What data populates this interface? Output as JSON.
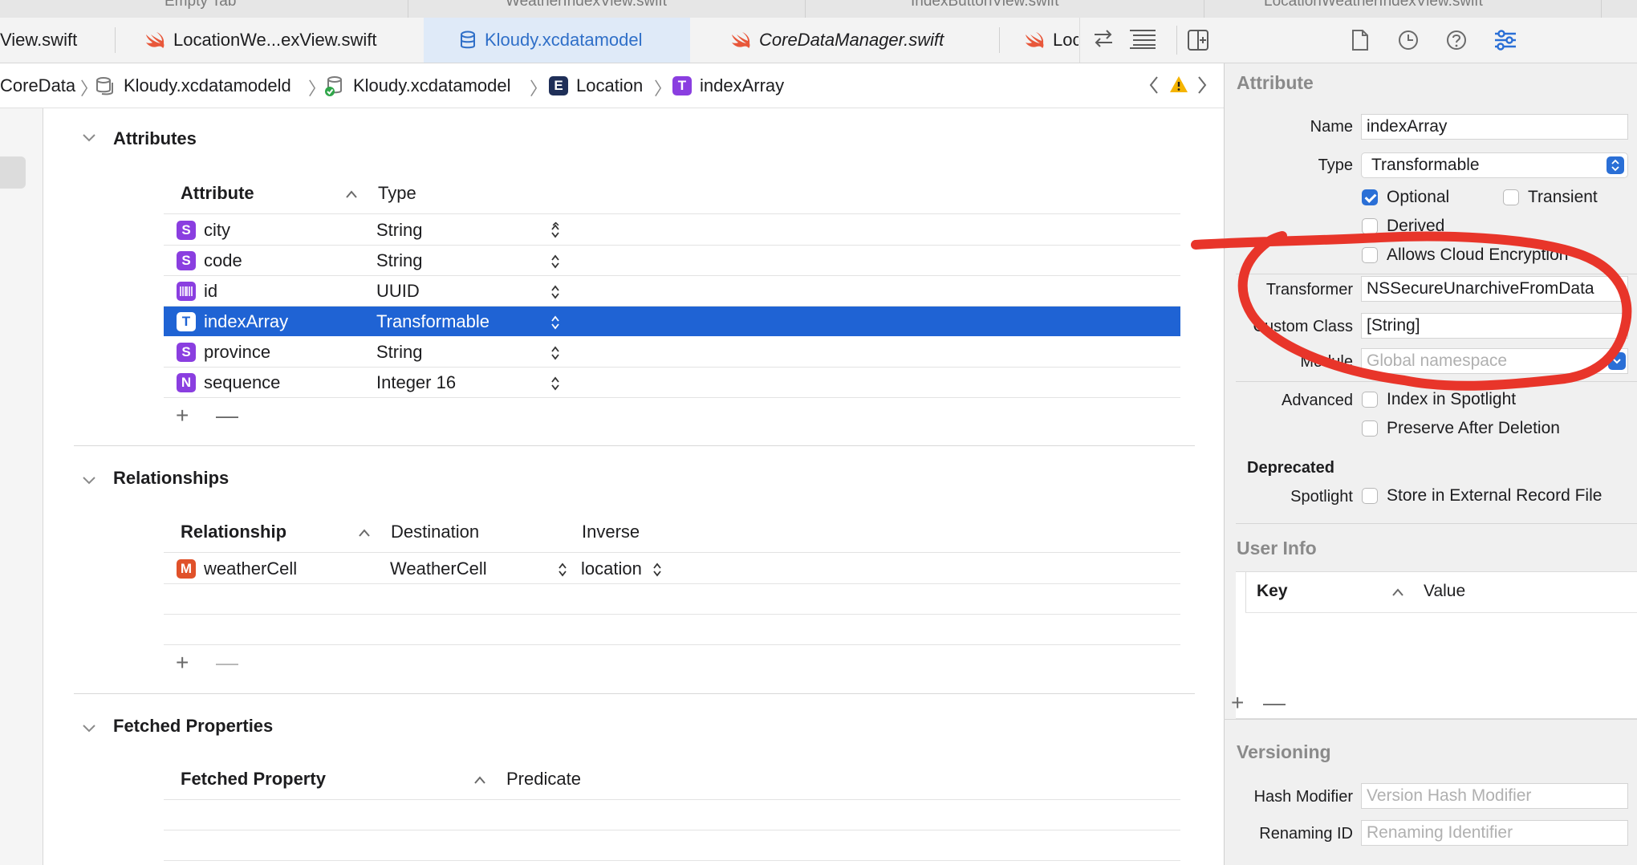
{
  "top_files": [
    "Empty Tab",
    "WeatherIndexView.swift",
    "IndexButtonView.swift",
    "LocationWeatherIndexView.swift"
  ],
  "tabs": [
    {
      "label": "View.swift",
      "icon": "none",
      "active": false
    },
    {
      "label": "LocationWe...exView.swift",
      "icon": "swift-icon",
      "active": false
    },
    {
      "label": "Kloudy.xcdatamodel",
      "icon": "datamodel-icon",
      "active": true
    },
    {
      "label": "CoreDataManager.swift",
      "icon": "swift-icon",
      "active": false
    },
    {
      "label": "Loc",
      "icon": "swift-icon",
      "active": false
    }
  ],
  "breadcrumb": [
    {
      "label": "CoreData"
    },
    {
      "label": "Kloudy.xcdatamodeld"
    },
    {
      "label": "Kloudy.xcdatamodel"
    },
    {
      "label": "Location",
      "badge": "E"
    },
    {
      "label": "indexArray",
      "badge": "T"
    }
  ],
  "attributes_section": {
    "title": "Attributes",
    "col_attribute": "Attribute",
    "col_type": "Type",
    "rows": [
      {
        "badge": "S",
        "name": "city",
        "type": "String",
        "selected": false
      },
      {
        "badge": "S",
        "name": "code",
        "type": "String",
        "selected": false
      },
      {
        "badge": "id-icon",
        "name": "id",
        "type": "UUID",
        "selected": false
      },
      {
        "badge": "T",
        "name": "indexArray",
        "type": "Transformable",
        "selected": true
      },
      {
        "badge": "S",
        "name": "province",
        "type": "String",
        "selected": false
      },
      {
        "badge": "N",
        "name": "sequence",
        "type": "Integer 16",
        "selected": false
      }
    ]
  },
  "relationships_section": {
    "title": "Relationships",
    "col_relationship": "Relationship",
    "col_destination": "Destination",
    "col_inverse": "Inverse",
    "rows": [
      {
        "badge": "M",
        "name": "weatherCell",
        "destination": "WeatherCell",
        "inverse": "location"
      }
    ]
  },
  "fetched_section": {
    "title": "Fetched Properties",
    "col_fetched": "Fetched Property",
    "col_predicate": "Predicate"
  },
  "controls": {
    "add": "+",
    "remove": "—"
  },
  "inspector": {
    "attribute_title": "Attribute",
    "name_label": "Name",
    "name_value": "indexArray",
    "type_label": "Type",
    "type_value": "Transformable",
    "optional_label": "Optional",
    "optional_checked": true,
    "transient_label": "Transient",
    "transient_checked": false,
    "derived_label": "Derived",
    "cloud_label": "Allows Cloud Encryption",
    "transformer_label": "Transformer",
    "transformer_value": "NSSecureUnarchiveFromData",
    "custom_class_label": "Custom Class",
    "custom_class_value": "[String]",
    "module_label": "Module",
    "module_placeholder": "Global namespace",
    "advanced_label": "Advanced",
    "spotlight_index_label": "Index in Spotlight",
    "preserve_label": "Preserve After Deletion",
    "deprecated_label": "Deprecated",
    "spotlight_label": "Spotlight",
    "external_label": "Store in External Record File",
    "user_info_title": "User Info",
    "key_col": "Key",
    "value_col": "Value",
    "versioning_title": "Versioning",
    "hash_label": "Hash Modifier",
    "hash_placeholder": "Version Hash Modifier",
    "renaming_label": "Renaming ID",
    "renaming_placeholder": "Renaming Identifier"
  },
  "colors": {
    "accent": "#1f63d4",
    "annotation": "#e8352a",
    "badge_purple": "#8a3ee0",
    "badge_orange": "#e0512a",
    "entity_navy": "#1f2f58"
  }
}
